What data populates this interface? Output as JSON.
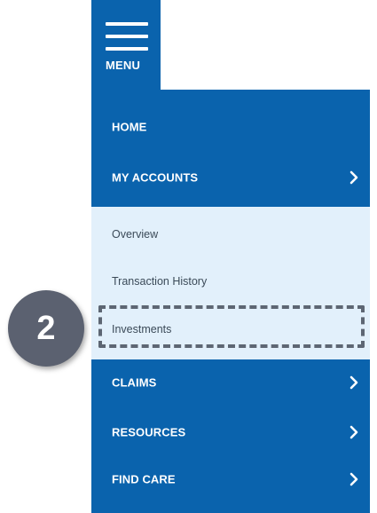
{
  "menu": {
    "label": "MENU",
    "icon": "hamburger-icon"
  },
  "nav": {
    "home": {
      "label": "HOME"
    },
    "my_accounts": {
      "label": "MY ACCOUNTS",
      "icon": "chevron-right-icon"
    },
    "claims": {
      "label": "CLAIMS",
      "icon": "chevron-right-icon"
    },
    "resources": {
      "label": "RESOURCES",
      "icon": "chevron-right-icon"
    },
    "find_care": {
      "label": "FIND CARE",
      "icon": "chevron-right-icon"
    }
  },
  "submenu": {
    "items": [
      {
        "label": "Overview"
      },
      {
        "label": "Transaction History"
      },
      {
        "label": "Investments"
      }
    ]
  },
  "callout": {
    "step": "2"
  },
  "colors": {
    "menu_blue": "#0a63ad",
    "submenu_bg": "#e2f0fb",
    "badge": "#5b6170",
    "dashed_border": "#5d6673"
  }
}
